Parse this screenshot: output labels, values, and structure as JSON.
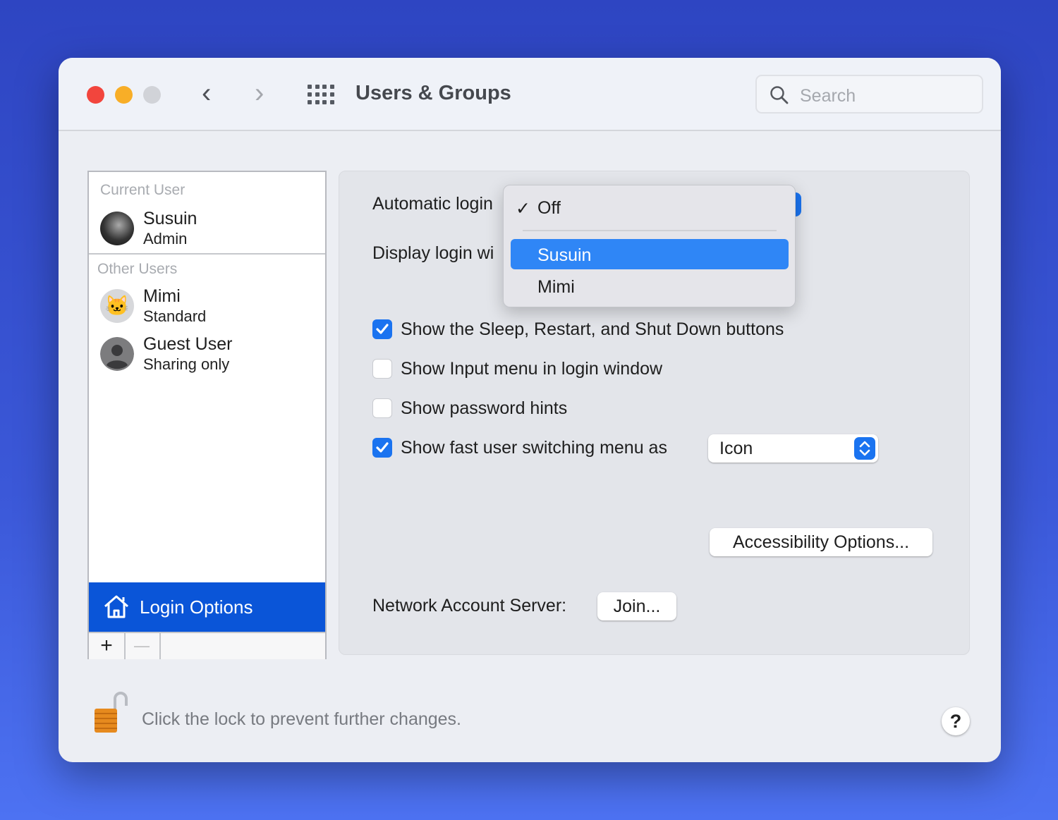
{
  "window": {
    "title": "Users & Groups",
    "search_placeholder": "Search"
  },
  "sidebar": {
    "current_header": "Current User",
    "other_header": "Other Users",
    "users": [
      {
        "name": "Susuin",
        "role": "Admin"
      },
      {
        "name": "Mimi",
        "role": "Standard"
      },
      {
        "name": "Guest User",
        "role": "Sharing only"
      }
    ],
    "login_options": "Login Options",
    "add": "+",
    "remove": "—"
  },
  "main": {
    "automatic_login_label": "Automatic login",
    "display_login_label": "Display login wi",
    "dropdown": {
      "items": [
        {
          "label": "Off",
          "checked": true
        },
        {
          "label": "Susuin",
          "highlighted": true
        },
        {
          "label": "Mimi"
        }
      ],
      "check": "✓"
    },
    "checkboxes": [
      {
        "label": "Show the Sleep, Restart, and Shut Down buttons",
        "checked": true
      },
      {
        "label": "Show Input menu in login window",
        "checked": false
      },
      {
        "label": "Show password hints",
        "checked": false
      },
      {
        "label": "Show fast user switching menu as",
        "checked": true
      }
    ],
    "switching_select": "Icon",
    "accessibility_button": "Accessibility Options...",
    "network_label": "Network Account Server:",
    "join_button": "Join..."
  },
  "footer": {
    "lock_text": "Click the lock to prevent further changes.",
    "help": "?"
  },
  "colors": {
    "accent": "#1a73f0",
    "selection": "#0a55d8",
    "menu_highlight": "#2f86f6"
  }
}
